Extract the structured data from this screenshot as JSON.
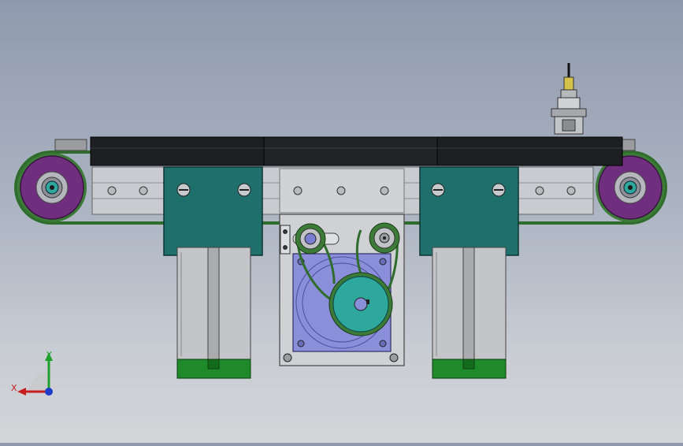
{
  "viewport": {
    "background_top": "#8f9aae",
    "background_bottom": "#d3d5d8"
  },
  "colors": {
    "roller_purple": "#6f2f7e",
    "bracket_teal": "#1f6f6c",
    "motor_face": "#8b8ed9",
    "pulley_cyan": "#2ea79d",
    "belt_green": "#3c7a38",
    "cylinder_foot": "#1f8a2a",
    "frame_gray": "#c9cbd0",
    "top_plate": "#1e1f22"
  },
  "triad": {
    "x_label": "X",
    "y_label": "Y",
    "x_color": "#c81e1e",
    "y_color": "#1fa02a",
    "z_color": "#1e3cc8"
  },
  "icons": [
    "triad-icon"
  ]
}
